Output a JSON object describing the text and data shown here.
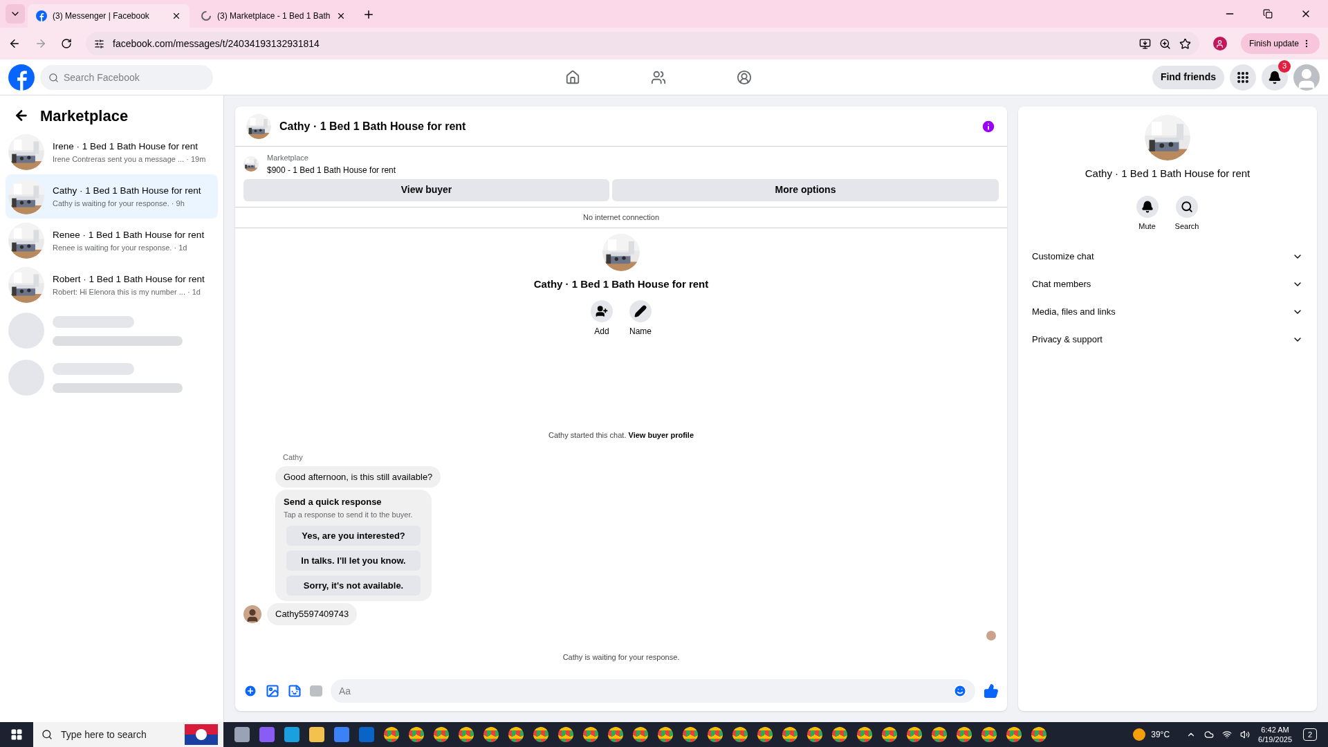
{
  "browser": {
    "tabs": [
      {
        "title": "(3) Messenger | Facebook",
        "selected": true
      },
      {
        "title": "(3) Marketplace - 1 Bed 1 Bath",
        "selected": false
      }
    ],
    "url": "facebook.com/messages/t/24034193132931814",
    "update_button": "Finish update"
  },
  "header": {
    "search_placeholder": "Search Facebook",
    "find_friends": "Find friends",
    "notification_count": "3"
  },
  "sidebar": {
    "title": "Marketplace",
    "conversations": [
      {
        "title": "Irene · 1 Bed 1 Bath House for rent",
        "preview": "Irene Contreras sent you a message ...",
        "time": "· 19m",
        "selected": false
      },
      {
        "title": "Cathy · 1 Bed 1 Bath House for rent",
        "preview": "Cathy is waiting for your response.",
        "time": "· 9h",
        "selected": true
      },
      {
        "title": "Renee · 1 Bed 1 Bath House for rent",
        "preview": "Renee is waiting for your response.",
        "time": "· 1d",
        "selected": false
      },
      {
        "title": "Robert · 1 Bed 1 Bath House for rent",
        "preview": "Robert: Hi Elenora this is my number ...",
        "time": "· 1d",
        "selected": false
      }
    ],
    "loading_rows": [
      {
        "kind": "skeleton"
      },
      {
        "kind": "skeleton"
      }
    ]
  },
  "chat": {
    "title": "Cathy · 1 Bed 1 Bath House for rent",
    "listing": {
      "label": "Marketplace",
      "text": "$900 - 1 Bed 1 Bath House for rent"
    },
    "buttons": [
      "View buyer",
      "More options"
    ],
    "status": "No internet connection",
    "profile_name": "Cathy · 1 Bed 1 Bath House for rent",
    "actions": [
      {
        "kind": "add",
        "label": "Add"
      },
      {
        "kind": "name",
        "label": "Name"
      }
    ],
    "started_note": "Cathy started this chat.",
    "started_link": "View buyer profile",
    "sender": "Cathy",
    "first_message": "Good afternoon, is this still available?",
    "quick_response": {
      "title": "Send a quick response",
      "subtitle": "Tap a response to send it to the buyer.",
      "options": [
        "Yes, are you interested?",
        "In talks. I'll let you know.",
        "Sorry, it's not available."
      ]
    },
    "second_message": "Cathy5597409743",
    "waiting_note": "Cathy is waiting for your response.",
    "composer_placeholder": "Aa"
  },
  "details": {
    "name": "Cathy · 1 Bed 1 Bath House for rent",
    "actions": [
      {
        "kind": "mute",
        "label": "Mute"
      },
      {
        "kind": "search",
        "label": "Search"
      }
    ],
    "sections": [
      {
        "label": "Customize chat",
        "expanded": false
      },
      {
        "label": "Chat members",
        "expanded": false
      },
      {
        "label": "Media, files and links",
        "expanded": false
      },
      {
        "label": "Privacy & support",
        "expanded": false
      }
    ]
  },
  "taskbar": {
    "search_placeholder": "Type here to search",
    "temperature": "39°C",
    "time": "6:42 AM",
    "date": "6/19/2025",
    "notification_count": "2"
  }
}
